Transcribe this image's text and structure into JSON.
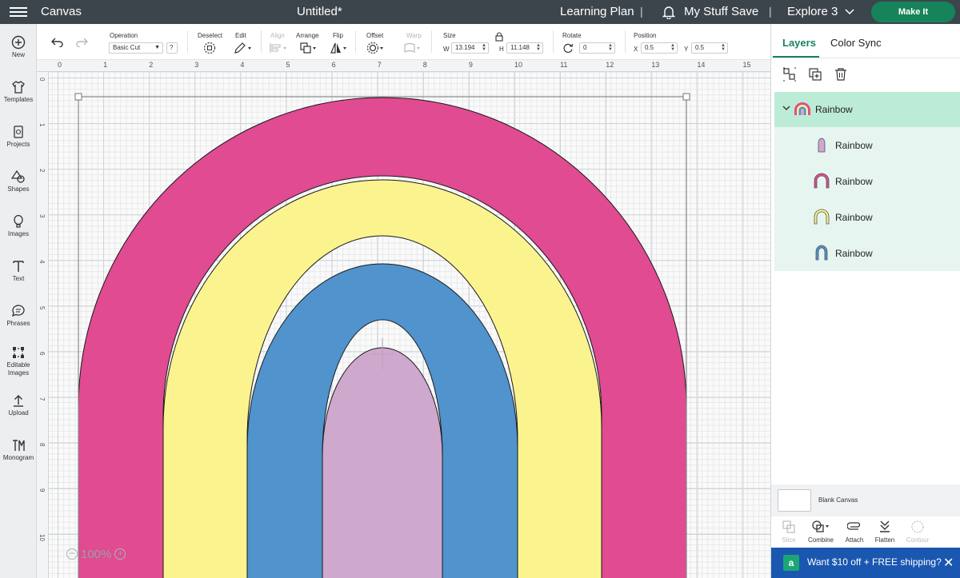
{
  "topbar": {
    "app_title": "Canvas",
    "doc_title": "Untitled*",
    "learning_plan": "Learning Plan",
    "separator": "|",
    "my_stuff": "My Stuff",
    "save": "Save",
    "machine": "Explore 3",
    "make_it": "Make It",
    "icons": [
      "menu-icon",
      "bell-icon",
      "chevron-down-icon"
    ]
  },
  "sidebar": {
    "items": [
      {
        "label": "New",
        "icon": "plus-circle-icon"
      },
      {
        "label": "Templates",
        "icon": "shirt-icon"
      },
      {
        "label": "Projects",
        "icon": "projects-icon"
      },
      {
        "label": "Shapes",
        "icon": "shapes-icon"
      },
      {
        "label": "Images",
        "icon": "balloon-icon"
      },
      {
        "label": "Text",
        "icon": "text-icon"
      },
      {
        "label": "Phrases",
        "icon": "speech-bubble-icon"
      },
      {
        "label": "Editable",
        "label2": "Images",
        "icon": "editable-images-icon"
      },
      {
        "label": "Upload",
        "icon": "upload-icon"
      },
      {
        "label": "Monogram",
        "icon": "monogram-icon"
      }
    ]
  },
  "toolbar": {
    "operation_label": "Operation",
    "operation_value": "Basic Cut",
    "help": "?",
    "deselect": "Deselect",
    "edit": "Edit",
    "align": "Align",
    "arrange": "Arrange",
    "flip": "Flip",
    "offset": "Offset",
    "warp": "Warp",
    "size": "Size",
    "w_label": "W",
    "w_value": "13.194",
    "h_label": "H",
    "h_value": "11.148",
    "rotate": "Rotate",
    "rotate_value": "0",
    "position": "Position",
    "x_label": "X",
    "x_value": "0.5",
    "y_label": "Y",
    "y_value": "0.5"
  },
  "rulers": {
    "top": [
      "0",
      "1",
      "2",
      "3",
      "4",
      "5",
      "6",
      "7",
      "8",
      "9",
      "10",
      "11",
      "12",
      "13",
      "14",
      "15"
    ],
    "left": [
      "0",
      "1",
      "2",
      "3",
      "4",
      "5",
      "6",
      "7",
      "8",
      "9",
      "10"
    ]
  },
  "canvas": {
    "zoom": "100%",
    "zoom_out": "−",
    "zoom_in": "+",
    "colors": {
      "pink": "#e04b91",
      "yellow": "#fbf38e",
      "blue": "#5093cd",
      "lilac": "#cfa8ce"
    }
  },
  "panel": {
    "tabs": [
      "Layers",
      "Color Sync"
    ],
    "layer_actions": [
      "group-icon",
      "duplicate-icon",
      "trash-icon"
    ],
    "group": {
      "name": "Rainbow",
      "icon": "rainbow-icon"
    },
    "layers": [
      {
        "name": "Rainbow",
        "icon": "lilac-drop-icon",
        "color": "#cfa8ce"
      },
      {
        "name": "Rainbow",
        "icon": "pink-arch-icon",
        "color": "#e04b91"
      },
      {
        "name": "Rainbow",
        "icon": "yellow-arch-icon",
        "color": "#fbf38e"
      },
      {
        "name": "Rainbow",
        "icon": "blue-arch-icon",
        "color": "#5093cd"
      }
    ],
    "blank_canvas": "Blank Canvas",
    "bottom_tools": [
      "Slice",
      "Combine",
      "Attach",
      "Flatten",
      "Contour"
    ],
    "promo": "Want $10 off + FREE shipping?",
    "promo_badge": "a",
    "promo_close": "✕"
  }
}
